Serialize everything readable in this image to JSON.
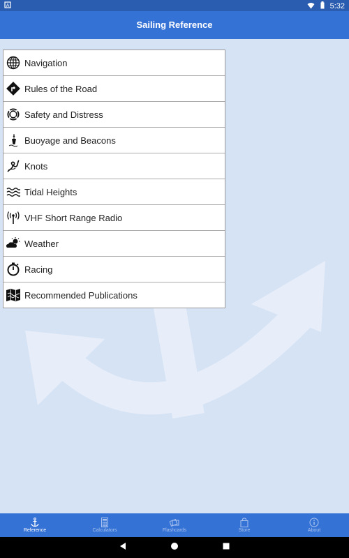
{
  "status_bar": {
    "time": "5:32",
    "notification_icon": "android-notification-icon",
    "wifi_icon": "wifi-icon",
    "battery_icon": "battery-icon"
  },
  "app_bar": {
    "title": "Sailing Reference"
  },
  "menu": {
    "items": [
      {
        "label": "Navigation",
        "icon": "globe-icon"
      },
      {
        "label": "Rules of the Road",
        "icon": "road-sign-icon"
      },
      {
        "label": "Safety and Distress",
        "icon": "lifebuoy-icon"
      },
      {
        "label": "Buoyage and Beacons",
        "icon": "buoy-icon"
      },
      {
        "label": "Knots",
        "icon": "knot-icon"
      },
      {
        "label": "Tidal Heights",
        "icon": "waves-icon"
      },
      {
        "label": "VHF Short Range Radio",
        "icon": "radio-antenna-icon"
      },
      {
        "label": "Weather",
        "icon": "weather-icon"
      },
      {
        "label": "Racing",
        "icon": "stopwatch-icon"
      },
      {
        "label": "Recommended Publications",
        "icon": "map-book-icon"
      }
    ]
  },
  "bottom_nav": {
    "tabs": [
      {
        "label": "Reference",
        "icon": "anchor-icon",
        "active": true
      },
      {
        "label": "Calculators",
        "icon": "calculator-icon",
        "active": false
      },
      {
        "label": "Flashcards",
        "icon": "flashcards-icon",
        "active": false
      },
      {
        "label": "Store",
        "icon": "shopping-bag-icon",
        "active": false
      },
      {
        "label": "About",
        "icon": "info-icon",
        "active": false
      }
    ]
  },
  "colors": {
    "primary": "#3572d6",
    "status_bar": "#2a5db0",
    "background": "#d6e3f4"
  }
}
